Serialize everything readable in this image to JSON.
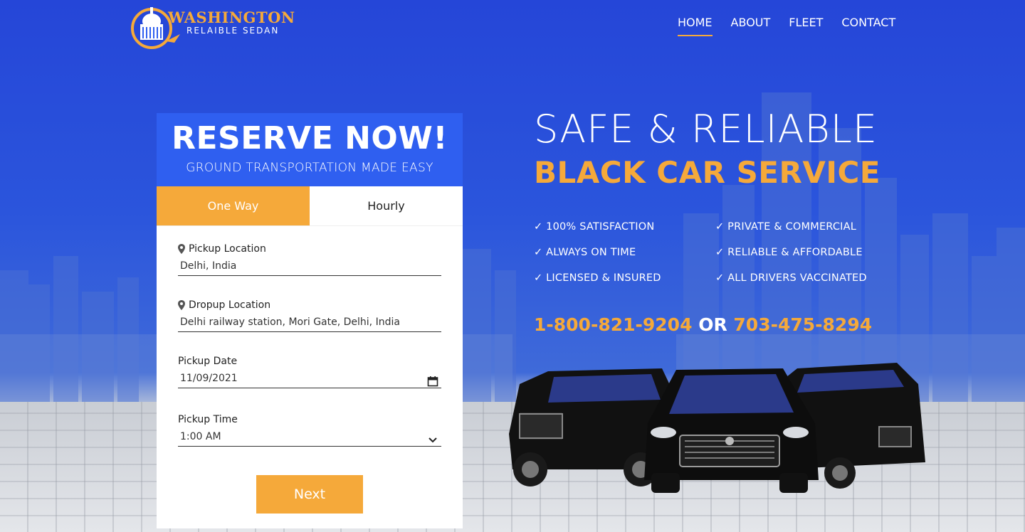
{
  "brand": {
    "name_line1": "WASHINGTON",
    "name_line2": "RELAIBLE SEDAN",
    "accent": "#f5a93a",
    "primary": "#2f5ff0"
  },
  "nav": {
    "items": [
      {
        "label": "HOME",
        "active": true
      },
      {
        "label": "ABOUT",
        "active": false
      },
      {
        "label": "FLEET",
        "active": false
      },
      {
        "label": "CONTACT",
        "active": false
      }
    ]
  },
  "form": {
    "title": "RESERVE NOW!",
    "subtitle": "GROUND TRANSPORTATION MADE EASY",
    "tabs": [
      {
        "label": "One Way",
        "active": true
      },
      {
        "label": "Hourly",
        "active": false
      }
    ],
    "pickup_location": {
      "label": "Pickup Location",
      "value": "Delhi, India",
      "icon": "map-marker-icon"
    },
    "dropup_location": {
      "label": "Dropup Location",
      "value": "Delhi railway station, Mori Gate, Delhi, India",
      "icon": "map-marker-icon"
    },
    "pickup_date": {
      "label": "Pickup Date",
      "value": "11/09/2021",
      "icon": "calendar-icon"
    },
    "pickup_time": {
      "label": "Pickup Time",
      "value": "1:00 AM",
      "icon": "chevron-down-icon"
    },
    "next_label": "Next"
  },
  "hero": {
    "title_line1": "SAFE & RELIABLE",
    "title_line2": "BLACK CAR SERVICE",
    "features": [
      "✓  100% SATISFACTION",
      "✓ PRIVATE & COMMERCIAL",
      "✓ ALWAYS ON TIME",
      "✓ RELIABLE & AFFORDABLE",
      "✓ LICENSED & INSURED",
      "✓ ALL DRIVERS VACCINATED"
    ],
    "phone1": "1-800-821-9204",
    "or_text": " OR ",
    "phone2": "703-475-8294"
  }
}
